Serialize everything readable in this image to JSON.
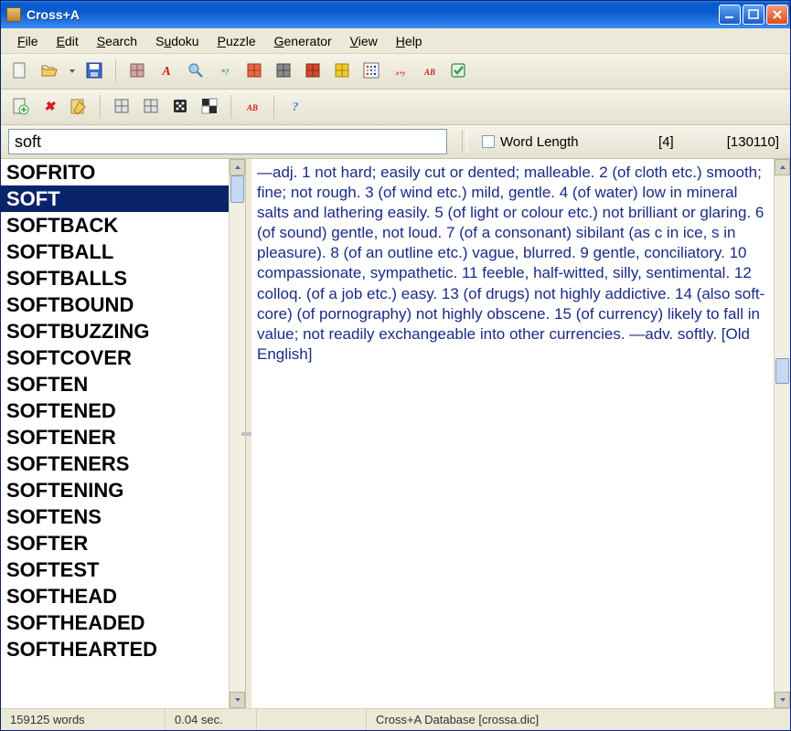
{
  "title": "Cross+A",
  "menus": [
    {
      "label": "File",
      "u": 0
    },
    {
      "label": "Edit",
      "u": 0
    },
    {
      "label": "Search",
      "u": 0
    },
    {
      "label": "Sudoku",
      "u": 1
    },
    {
      "label": "Puzzle",
      "u": 0
    },
    {
      "label": "Generator",
      "u": 0
    },
    {
      "label": "View",
      "u": 0
    },
    {
      "label": "Help",
      "u": 0
    }
  ],
  "toolbar1": [
    {
      "name": "new-icon",
      "fill": "#f5f5f0",
      "stroke": "#7a7a60",
      "extra": "fold"
    },
    {
      "name": "open-icon",
      "fill": "#f2cc5f",
      "stroke": "#a5781c",
      "dd": true
    },
    {
      "name": "save-icon",
      "fill": "#3a6fce",
      "stroke": "#1c3a7a"
    },
    {
      "sep": true
    },
    {
      "name": "grid-icon",
      "fill": "#cfa5a5",
      "stroke": "#8a5a5a"
    },
    {
      "name": "letter-a-icon",
      "fill": "#d21f1f",
      "stroke": "#8a1010",
      "text": "A"
    },
    {
      "name": "magnifier-icon",
      "fill": "#a5cfe6",
      "stroke": "#3a7aa5"
    },
    {
      "name": "wildcard-icon",
      "fill": "#5aa55a",
      "stroke": "#2a6a2a",
      "text": "*?"
    },
    {
      "name": "tree-icon",
      "fill": "#e26a4a",
      "stroke": "#a53a1a"
    },
    {
      "name": "calculator-icon",
      "fill": "#8a8a8a",
      "stroke": "#4a4a4a"
    },
    {
      "name": "levels-icon",
      "fill": "#d24a2a",
      "stroke": "#8a2a10"
    },
    {
      "name": "link-icon",
      "fill": "#f0c82a",
      "stroke": "#a5861a"
    },
    {
      "name": "matrix-icon",
      "fill": "#e2e2e2",
      "stroke": "#6a6a6a",
      "dots": true
    },
    {
      "name": "xy-icon",
      "fill": "#d21f1f",
      "stroke": "#8a1010",
      "text": "x+y"
    },
    {
      "name": "ab-icon",
      "fill": "#d21f1f",
      "stroke": "#2a8a2a",
      "text": "AB"
    },
    {
      "name": "check-icon",
      "fill": "#3aa53a",
      "stroke": "#1a6a1a"
    }
  ],
  "toolbar2": [
    {
      "name": "add-page-icon",
      "fill": "#f0f0e6",
      "stroke": "#7a7a60",
      "plus": "#3aa53a"
    },
    {
      "name": "delete-icon",
      "fill": "#d21f1f",
      "stroke": "#8a1010",
      "text": "✖"
    },
    {
      "name": "edit-icon",
      "fill": "#f0d88a",
      "stroke": "#a5861a"
    },
    {
      "sep": true
    },
    {
      "name": "mode1-icon",
      "fill": "#e2e2e2",
      "stroke": "#6a6a6a"
    },
    {
      "name": "mode2-icon",
      "fill": "#e2e2e2",
      "stroke": "#6a6a6a"
    },
    {
      "name": "dice-icon",
      "fill": "#2a2a2a",
      "stroke": "#000"
    },
    {
      "name": "squares-icon",
      "fill": "#e2e2e2",
      "stroke": "#2a2a2a",
      "checker": true
    },
    {
      "sep": true
    },
    {
      "name": "ab2-icon",
      "fill": "#d21f1f",
      "stroke": "#2a8a2a",
      "text": "AB"
    },
    {
      "sep": true
    },
    {
      "name": "help-icon",
      "fill": "#4a8ad6",
      "stroke": "#1c4a8a",
      "text": "?"
    }
  ],
  "search": {
    "value": "soft",
    "word_length_label": "Word Length",
    "word_length_value": "[4]",
    "total": "[130110]"
  },
  "words": [
    "SOFRITO",
    "SOFT",
    "SOFTBACK",
    "SOFTBALL",
    "SOFTBALLS",
    "SOFTBOUND",
    "SOFTBUZZING",
    "SOFTCOVER",
    "SOFTEN",
    "SOFTENED",
    "SOFTENER",
    "SOFTENERS",
    "SOFTENING",
    "SOFTENS",
    "SOFTER",
    "SOFTEST",
    "SOFTHEAD",
    "SOFTHEADED",
    "SOFTHEARTED"
  ],
  "selected_index": 1,
  "definition": "—adj. 1 not hard; easily cut or dented; malleable. 2 (of cloth etc.) smooth; fine; not rough. 3 (of wind etc.) mild, gentle. 4 (of water) low in mineral salts and lathering easily. 5 (of light or colour etc.) not brilliant or glaring. 6 (of sound) gentle, not loud. 7 (of a consonant) sibilant (as c in ice, s in pleasure). 8 (of an outline etc.) vague, blurred. 9 gentle, conciliatory. 10 compassionate, sympathetic. 11 feeble, half-witted, silly, sentimental. 12 colloq. (of a job etc.) easy. 13 (of drugs) not highly addictive. 14 (also soft-core) (of pornography) not highly obscene. 15 (of currency) likely to fall in value; not readily exchangeable into other currencies. —adv. softly. [Old English]",
  "status": {
    "word_count": "159125 words",
    "time": "0.04 sec.",
    "db": "Cross+A Database [crossa.dic]"
  }
}
